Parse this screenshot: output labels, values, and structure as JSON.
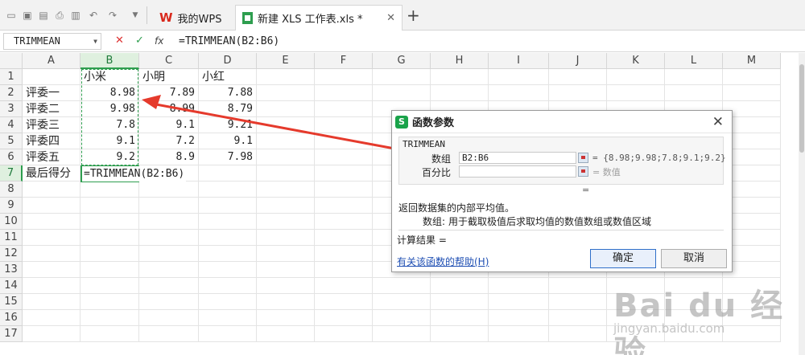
{
  "tabs": {
    "home_label": "我的WPS",
    "doc_label": "新建 XLS 工作表.xls *",
    "close_glyph": "✕",
    "new_tab_glyph": "+"
  },
  "formula_bar": {
    "name_box": "TRIMMEAN",
    "cancel_glyph": "✕",
    "confirm_glyph": "✓",
    "fx_label": "fx",
    "formula": "=TRIMMEAN(B2:B6)"
  },
  "grid": {
    "columns": [
      "A",
      "B",
      "C",
      "D",
      "E",
      "F",
      "G",
      "H",
      "I",
      "J",
      "K",
      "L",
      "M"
    ],
    "rows": [
      "1",
      "2",
      "3",
      "4",
      "5",
      "6",
      "7",
      "8",
      "9",
      "10",
      "11",
      "12",
      "13",
      "14",
      "15",
      "16",
      "17"
    ],
    "header": {
      "b": "小米",
      "c": "小明",
      "d": "小红"
    },
    "judges": [
      "评委一",
      "评委二",
      "评委三",
      "评委四",
      "评委五"
    ],
    "b_values": [
      "8.98",
      "9.98",
      "7.8",
      "9.1",
      "9.2"
    ],
    "c_values": [
      "7.89",
      "8.99",
      "9.1",
      "7.2",
      "8.9"
    ],
    "d_values": [
      "7.88",
      "8.79",
      "9.21",
      "9.1",
      "7.98"
    ],
    "final_label": "最后得分",
    "editing_formula": "=TRIMMEAN(B2:B6)"
  },
  "dialog": {
    "title": "函数参数",
    "logo_text": "S",
    "close_glyph": "✕",
    "function_name": "TRIMMEAN",
    "array_label": "数组",
    "array_value": "B2:B6",
    "array_result": "= {8.98;9.98;7.8;9.1;9.2}",
    "percent_label": "百分比",
    "percent_value": "",
    "percent_result": "= 数值",
    "equals": "=",
    "description": "返回数据集的内部平均值。",
    "param_desc_label": "数组:",
    "param_desc": "用于截取极值后求取均值的数值数组或数值区域",
    "calc_result": "计算结果 =",
    "help_link": "有关该函数的帮助(H)",
    "ok_label": "确定",
    "cancel_label": "取消"
  },
  "watermark": {
    "brand": "Bai du 经验",
    "url": "jingyan.baidu.com"
  },
  "colors": {
    "selection_green": "#2e9e4f",
    "arrow_red": "#e53a2c",
    "link_blue": "#1f4fb3"
  }
}
